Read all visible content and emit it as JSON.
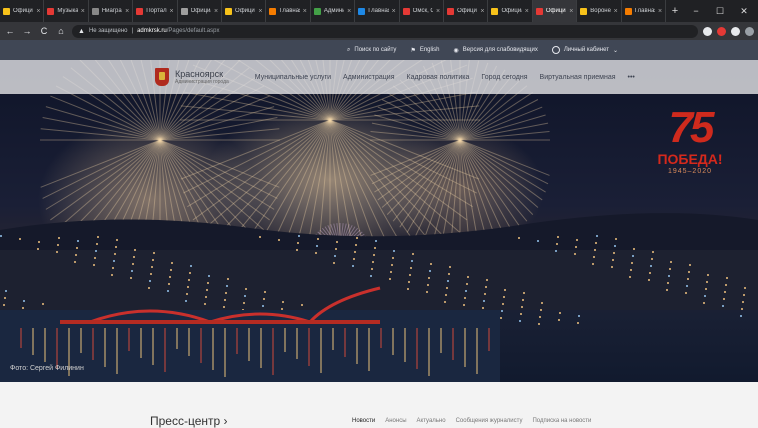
{
  "browser": {
    "tabs": [
      {
        "label": "Официал",
        "color": "#f7c21a",
        "active": false
      },
      {
        "label": "Музыка",
        "color": "#e53935",
        "active": false
      },
      {
        "label": "Ниаграф",
        "color": "#888888",
        "active": false
      },
      {
        "label": "Портал",
        "color": "#e53935",
        "active": false
      },
      {
        "label": "Официал",
        "color": "#9e9e9e",
        "active": false
      },
      {
        "label": "Официал",
        "color": "#f7c21a",
        "active": false
      },
      {
        "label": "Главная",
        "color": "#f57c00",
        "active": false
      },
      {
        "label": "Админис",
        "color": "#43a047",
        "active": false
      },
      {
        "label": "Главная",
        "color": "#1e88e5",
        "active": false
      },
      {
        "label": "Омск, О",
        "color": "#e53935",
        "active": false
      },
      {
        "label": "Официал",
        "color": "#e53935",
        "active": false
      },
      {
        "label": "Официал",
        "color": "#f7c21a",
        "active": false
      },
      {
        "label": "Официал",
        "color": "#e53935",
        "active": true
      },
      {
        "label": "Воронеж",
        "color": "#f7c21a",
        "active": false
      },
      {
        "label": "Главная",
        "color": "#f57c00",
        "active": false
      }
    ],
    "new_tab": "+",
    "window_controls": [
      "−",
      "☐",
      "✕"
    ],
    "nav": {
      "back": "←",
      "forward": "→",
      "reload": "C",
      "home": "⌂"
    },
    "address": {
      "security": "Не защищено",
      "domain": "admkrsk.ru",
      "path": "/Pages/default.aspx"
    },
    "extension_colors": [
      "#e8eaed",
      "#e53935",
      "#e8eaed",
      "#9aa0a6"
    ]
  },
  "site": {
    "utility": {
      "search": "Поиск по сайту",
      "english": "English",
      "low_vision": "Версия для слабовидящих",
      "account": "Личный кабинет"
    },
    "logo": {
      "city": "Красноярск",
      "subtitle": "Администрация города"
    },
    "menu": [
      "Муниципальные услуги",
      "Администрация",
      "Кадровая политика",
      "Город сегодня",
      "Виртуальная приемная",
      "•••"
    ],
    "hero": {
      "victory_number": "75",
      "victory_word": "ПОБЕДА!",
      "victory_years": "1945–2020",
      "photo_credit": "Фото: Сергей Филинин"
    },
    "press": {
      "title": "Пресс-центр",
      "arrow": "›",
      "tabs": [
        "Новости",
        "Анонсы",
        "Актуально",
        "Сообщения журналисту",
        "Подписка на новости"
      ]
    }
  }
}
